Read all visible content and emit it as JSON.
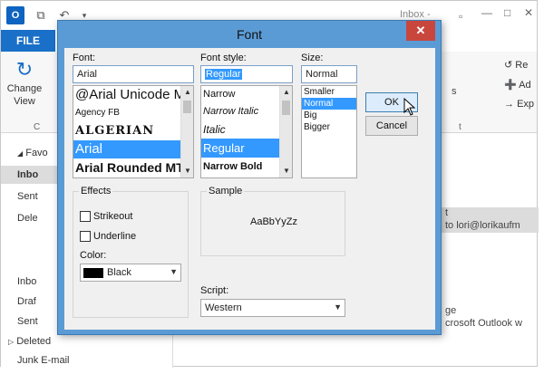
{
  "outlook": {
    "app_icon": "O",
    "window_title": "Inbox - ",
    "file_tab": "FILE",
    "change_view": "Change View",
    "ribbon_right": [
      "Re",
      "Ad",
      "Exp"
    ],
    "nav": {
      "favorites": "Favo",
      "items": [
        "Inbo",
        "Sent",
        "Dele",
        "Inbo",
        "Draf",
        "Sent",
        "Deleted",
        "Junk E-mail"
      ]
    },
    "right_pane": {
      "line1": "t",
      "line2": "to lori@lorikaufm",
      "line3": "ge",
      "line4": "crosoft Outlook w"
    }
  },
  "dialog": {
    "title": "Font",
    "close": "✕",
    "font_label": "Font:",
    "font_value": "Arial",
    "font_list": [
      {
        "name": "@Arial Unicode MS",
        "selected": false
      },
      {
        "name": "Agency FB",
        "selected": false
      },
      {
        "name": "ALGERIAN",
        "selected": false
      },
      {
        "name": "Arial",
        "selected": true
      },
      {
        "name": "Arial Rounded MT",
        "selected": false
      }
    ],
    "style_label": "Font style:",
    "style_value": "Regular",
    "style_list": [
      {
        "name": "Narrow",
        "selected": false
      },
      {
        "name": "Narrow Italic",
        "selected": false
      },
      {
        "name": "Italic",
        "selected": false
      },
      {
        "name": "Regular",
        "selected": true
      },
      {
        "name": "Narrow Bold",
        "selected": false
      }
    ],
    "size_label": "Size:",
    "size_value": "Normal",
    "size_list": [
      {
        "name": "Smaller",
        "selected": false
      },
      {
        "name": "Normal",
        "selected": true
      },
      {
        "name": "Big",
        "selected": false
      },
      {
        "name": "Bigger",
        "selected": false
      }
    ],
    "ok": "OK",
    "cancel": "Cancel",
    "effects_label": "Effects",
    "strikeout": "Strikeout",
    "underline": "Underline",
    "color_label": "Color:",
    "color_value": "Black",
    "sample_label": "Sample",
    "sample_text": "AaBbYyZz",
    "script_label": "Script:",
    "script_value": "Western"
  },
  "colors": {
    "dialog_frame": "#5b9bd5",
    "close_button": "#c9463d",
    "selection": "#3399ff",
    "file_tab": "#1a70c8"
  }
}
